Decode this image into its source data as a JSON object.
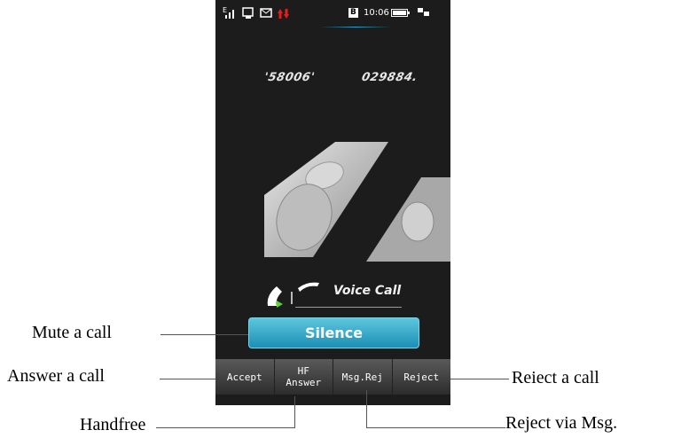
{
  "status_bar": {
    "signal_icon": "signal-strength-icon",
    "b_badge": "B",
    "time": "10:06",
    "battery_icon": "battery-icon"
  },
  "caller": {
    "number_left": "'58006'",
    "number_right": "029884."
  },
  "call_type": "Voice Call",
  "silence_button": "Silence",
  "soft_keys": {
    "accept": "Accept",
    "hf_top": "HF",
    "hf_bottom": "Answer",
    "msg_reject": "Msg.Rej",
    "reject": "Reject"
  },
  "annotations": {
    "mute": "Mute a call",
    "answer": "Answer a call",
    "handfree": "Handfree",
    "reject": "Reiect a call",
    "reject_msg": "Reject via Msg."
  },
  "colors": {
    "phone_bg": "#1c1c1c",
    "accent": "#2aa6cc",
    "reject_red": "#e02020"
  }
}
